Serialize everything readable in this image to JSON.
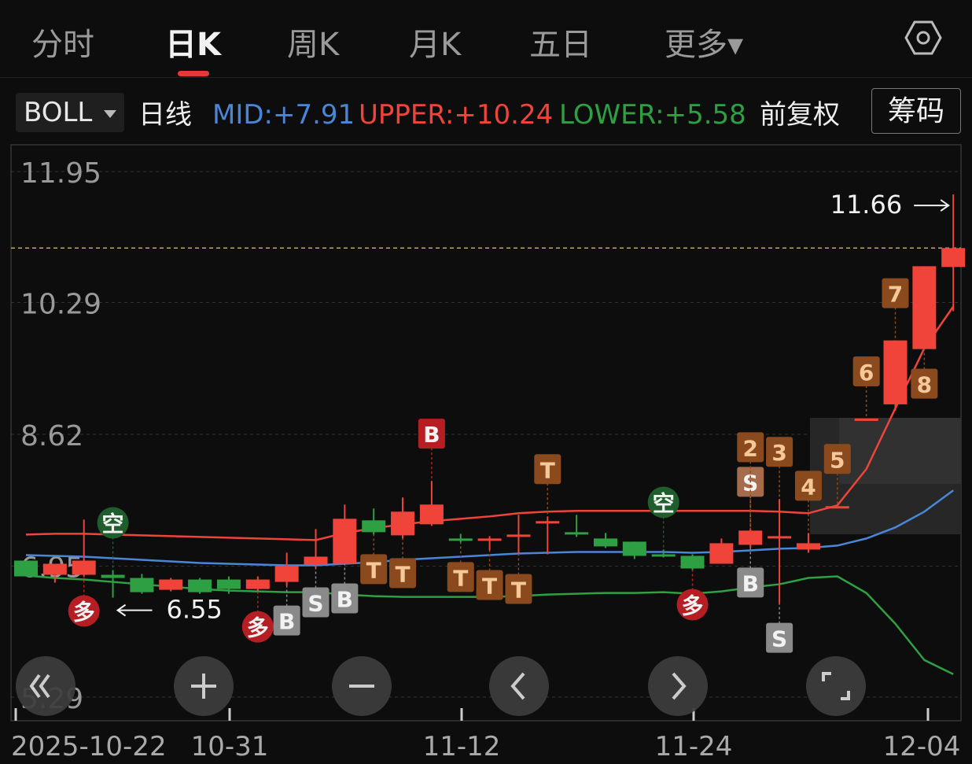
{
  "tabs": [
    {
      "label": "分时"
    },
    {
      "label": "日K"
    },
    {
      "label": "周K"
    },
    {
      "label": "月K"
    },
    {
      "label": "五日"
    },
    {
      "label": "更多▾"
    }
  ],
  "indicator_bar": {
    "selector": "BOLL",
    "period": "日线",
    "mid": "MID:+7.91",
    "upper": "UPPER:+10.24",
    "lower": "LOWER:+5.58",
    "adjust": "前复权",
    "chips_button": "筹码"
  },
  "colors": {
    "up": "#f0443a",
    "down": "#2ea043",
    "mid": "#4a86d8",
    "upper": "#f0443a",
    "lower": "#2ea043",
    "badge_orange": "#8b4a1d",
    "badge_red": "#b51f24",
    "badge_gray": "#8a8a8a",
    "badge_green": "#1f5e2c"
  },
  "y_axis": {
    "labels": [
      "11.95",
      "10.29",
      "8.62",
      "6.95",
      "5.29"
    ]
  },
  "x_axis": {
    "labels": [
      "2025-10-22",
      "10-31",
      "11-12",
      "11-24",
      "12-04"
    ]
  },
  "annotations": {
    "high": "11.66",
    "low": "6.55"
  },
  "controls": [
    {
      "icon": "rewind-icon"
    },
    {
      "icon": "zoom-in-icon"
    },
    {
      "icon": "zoom-out-icon"
    },
    {
      "icon": "chevron-left-icon"
    },
    {
      "icon": "chevron-right-icon"
    },
    {
      "icon": "fullscreen-icon"
    }
  ],
  "chart_data": {
    "type": "candlestick",
    "y_range": [
      5.29,
      11.95
    ],
    "x_labels": [
      "2025-10-22",
      "10-31",
      "11-12",
      "11-24",
      "12-04"
    ],
    "candles": [
      {
        "o": 7.02,
        "c": 6.82,
        "h": 7.02,
        "l": 6.82
      },
      {
        "o": 6.84,
        "c": 6.98,
        "h": 6.98,
        "l": 6.74
      },
      {
        "o": 6.84,
        "c": 7.02,
        "h": 7.54,
        "l": 6.82
      },
      {
        "o": 6.84,
        "c": 6.8,
        "h": 6.9,
        "l": 6.55
      },
      {
        "o": 6.8,
        "c": 6.62,
        "h": 6.85,
        "l": 6.6
      },
      {
        "o": 6.65,
        "c": 6.78,
        "h": 6.8,
        "l": 6.63
      },
      {
        "o": 6.78,
        "c": 6.62,
        "h": 6.8,
        "l": 6.6
      },
      {
        "o": 6.78,
        "c": 6.66,
        "h": 6.82,
        "l": 6.6
      },
      {
        "o": 6.66,
        "c": 6.78,
        "h": 6.82,
        "l": 6.62
      },
      {
        "o": 6.75,
        "c": 6.95,
        "h": 7.12,
        "l": 6.7
      },
      {
        "o": 6.97,
        "c": 7.07,
        "h": 7.42,
        "l": 6.93
      },
      {
        "o": 6.98,
        "c": 7.55,
        "h": 7.73,
        "l": 6.98
      },
      {
        "o": 7.53,
        "c": 7.38,
        "h": 7.68,
        "l": 7.35
      },
      {
        "o": 7.34,
        "c": 7.64,
        "h": 7.82,
        "l": 7.3
      },
      {
        "o": 7.48,
        "c": 7.73,
        "h": 8.03,
        "l": 7.46
      },
      {
        "o": 7.3,
        "c": 7.28,
        "h": 7.36,
        "l": 7.25
      },
      {
        "o": 7.3,
        "c": 7.3,
        "h": 7.33,
        "l": 7.15
      },
      {
        "o": 7.32,
        "c": 7.35,
        "h": 7.6,
        "l": 7.1
      },
      {
        "o": 7.52,
        "c": 7.52,
        "h": 7.58,
        "l": 7.1
      },
      {
        "o": 7.38,
        "c": 7.36,
        "h": 7.6,
        "l": 7.32
      },
      {
        "o": 7.3,
        "c": 7.2,
        "h": 7.37,
        "l": 7.18
      },
      {
        "o": 7.26,
        "c": 7.08,
        "h": 7.26,
        "l": 7.04
      },
      {
        "o": 7.1,
        "c": 7.08,
        "h": 7.16,
        "l": 7.06
      },
      {
        "o": 7.08,
        "c": 6.92,
        "h": 7.1,
        "l": 6.9
      },
      {
        "o": 6.98,
        "c": 7.24,
        "h": 7.3,
        "l": 6.98
      },
      {
        "o": 7.22,
        "c": 7.4,
        "h": 7.42,
        "l": 7.18
      },
      {
        "o": 7.33,
        "c": 7.33,
        "h": 7.8,
        "l": 6.48
      },
      {
        "o": 7.16,
        "c": 7.24,
        "h": 7.37,
        "l": 7.12
      },
      {
        "o": 7.71,
        "c": 7.71,
        "h": 7.71,
        "l": 7.71
      },
      {
        "o": 8.82,
        "c": 8.82,
        "h": 8.82,
        "l": 8.82
      },
      {
        "o": 9.0,
        "c": 9.81,
        "h": 9.81,
        "l": 8.92
      },
      {
        "o": 9.7,
        "c": 10.75,
        "h": 10.75,
        "l": 9.7
      },
      {
        "o": 10.74,
        "c": 10.98,
        "h": 11.66,
        "l": 10.18
      }
    ],
    "upper": [
      7.35,
      7.36,
      7.36,
      7.35,
      7.34,
      7.33,
      7.32,
      7.31,
      7.3,
      7.29,
      7.28,
      7.37,
      7.43,
      7.48,
      7.52,
      7.55,
      7.58,
      7.62,
      7.64,
      7.65,
      7.65,
      7.65,
      7.65,
      7.65,
      7.65,
      7.65,
      7.64,
      7.62,
      7.72,
      8.18,
      8.95,
      9.71,
      10.24
    ],
    "mid": [
      7.09,
      7.08,
      7.07,
      7.05,
      7.03,
      7.01,
      6.99,
      6.98,
      6.97,
      6.96,
      6.96,
      6.98,
      7.0,
      7.03,
      7.05,
      7.07,
      7.09,
      7.11,
      7.12,
      7.13,
      7.13,
      7.13,
      7.13,
      7.12,
      7.13,
      7.15,
      7.17,
      7.18,
      7.21,
      7.3,
      7.44,
      7.64,
      7.91
    ],
    "lower": [
      6.83,
      6.8,
      6.78,
      6.75,
      6.72,
      6.69,
      6.66,
      6.64,
      6.63,
      6.62,
      6.62,
      6.59,
      6.57,
      6.56,
      6.56,
      6.56,
      6.56,
      6.57,
      6.59,
      6.6,
      6.61,
      6.61,
      6.62,
      6.6,
      6.63,
      6.68,
      6.72,
      6.8,
      6.82,
      6.61,
      6.22,
      5.76,
      5.58
    ],
    "dashed_price_line": 10.98,
    "markers": [
      {
        "i": 3,
        "label": "空",
        "kind": "green-circle",
        "pos": "above"
      },
      {
        "i": 2,
        "label": "多",
        "kind": "red-circle",
        "pos": "below"
      },
      {
        "i": 8,
        "label": "多",
        "kind": "red-circle",
        "pos": "below"
      },
      {
        "i": 9,
        "label": "B",
        "kind": "gray",
        "pos": "below"
      },
      {
        "i": 10,
        "label": "S",
        "kind": "gray",
        "pos": "below"
      },
      {
        "i": 11,
        "label": "B",
        "kind": "gray",
        "pos": "below"
      },
      {
        "i": 12,
        "label": "T",
        "kind": "orange",
        "pos": "below"
      },
      {
        "i": 13,
        "label": "T",
        "kind": "orange",
        "pos": "below"
      },
      {
        "i": 14,
        "label": "B",
        "kind": "red",
        "pos": "above"
      },
      {
        "i": 15,
        "label": "T",
        "kind": "orange",
        "pos": "below"
      },
      {
        "i": 16,
        "label": "T",
        "kind": "orange",
        "pos": "below"
      },
      {
        "i": 17,
        "label": "T",
        "kind": "orange",
        "pos": "below"
      },
      {
        "i": 18,
        "label": "T",
        "kind": "orange",
        "pos": "above"
      },
      {
        "i": 22,
        "label": "空",
        "kind": "green-circle",
        "pos": "above"
      },
      {
        "i": 23,
        "label": "多",
        "kind": "red-circle",
        "pos": "below"
      },
      {
        "i": 25,
        "label": "S",
        "kind": "orange-s",
        "pos": "above"
      },
      {
        "i": 25,
        "label": "B",
        "kind": "gray",
        "pos": "below"
      },
      {
        "i": 26,
        "label": "S",
        "kind": "gray",
        "pos": "below"
      },
      {
        "i": 25,
        "label": "2",
        "kind": "orange",
        "pos": "above"
      },
      {
        "i": 26,
        "label": "3",
        "kind": "orange",
        "pos": "above"
      },
      {
        "i": 27,
        "label": "4",
        "kind": "orange",
        "pos": "above"
      },
      {
        "i": 28,
        "label": "5",
        "kind": "orange",
        "pos": "above"
      },
      {
        "i": 29,
        "label": "6",
        "kind": "orange",
        "pos": "above"
      },
      {
        "i": 30,
        "label": "7",
        "kind": "orange",
        "pos": "above"
      },
      {
        "i": 31,
        "label": "8",
        "kind": "orange",
        "pos": "below"
      }
    ]
  }
}
